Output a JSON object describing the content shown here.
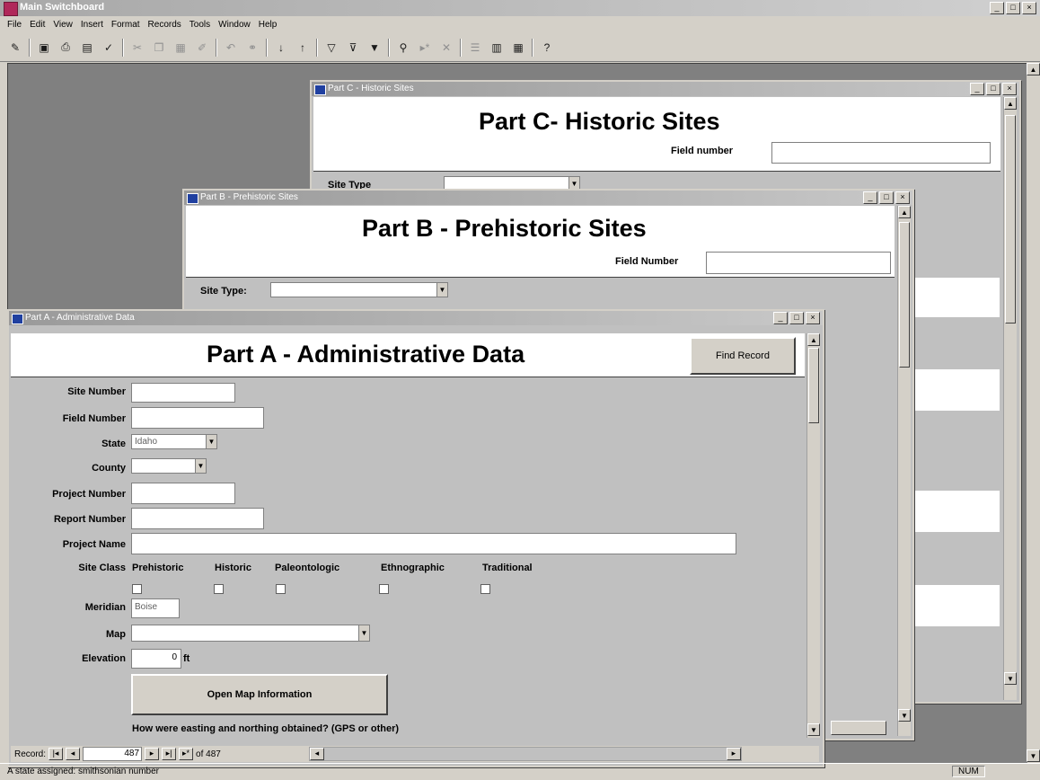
{
  "app": {
    "title": "Main Switchboard",
    "window_controls": [
      "_",
      "□",
      "×"
    ]
  },
  "menu": [
    "File",
    "Edit",
    "View",
    "Insert",
    "Format",
    "Records",
    "Tools",
    "Window",
    "Help"
  ],
  "toolbar_icons": [
    "view-icon",
    "save-icon",
    "print-icon",
    "print-preview-icon",
    "spelling-icon",
    "cut-icon",
    "copy-icon",
    "paste-icon",
    "format-painter-icon",
    "undo-icon",
    "hyperlink-icon",
    "sort-ascending-icon",
    "sort-descending-icon",
    "filter-by-selection-icon",
    "filter-by-form-icon",
    "apply-filter-icon",
    "find-icon",
    "new-record-icon",
    "delete-record-icon",
    "properties-icon",
    "database-window-icon",
    "new-object-icon",
    "help-icon"
  ],
  "part_c": {
    "title_bar": "Part C - Historic Sites",
    "heading": "Part C- Historic Sites",
    "field_label": "Field number",
    "site_type_label": "Site Type"
  },
  "part_b": {
    "title_bar": "Part B - Prehistoric Sites",
    "heading": "Part B - Prehistoric Sites",
    "field_label": "Field Number",
    "site_type_label": "Site Type:"
  },
  "part_a": {
    "title_bar": "Part A - Administrative Data",
    "heading": "Part A - Administrative Data",
    "find_button": "Find Record",
    "labels": {
      "site_number": "Site Number",
      "field_number": "Field Number",
      "state": "State",
      "county": "County",
      "project_number": "Project Number",
      "report_number": "Report Number",
      "project_name": "Project Name",
      "site_class": "Site Class",
      "meridian": "Meridian",
      "map": "Map",
      "elevation": "Elevation"
    },
    "values": {
      "state": "Idaho",
      "meridian": "Boise",
      "elevation": "0",
      "elevation_unit": "ft"
    },
    "site_classes": [
      "Prehistoric",
      "Historic",
      "Paleontologic",
      "Ethnographic",
      "Traditional"
    ],
    "open_map_button": "Open Map Information",
    "question": "How were easting and northing obtained? (GPS or other)",
    "record_nav": {
      "label": "Record:",
      "current": "487",
      "of_text": "of 487"
    }
  },
  "status": {
    "text": "A state assigned: smithsonian number",
    "indicator": "NUM"
  }
}
